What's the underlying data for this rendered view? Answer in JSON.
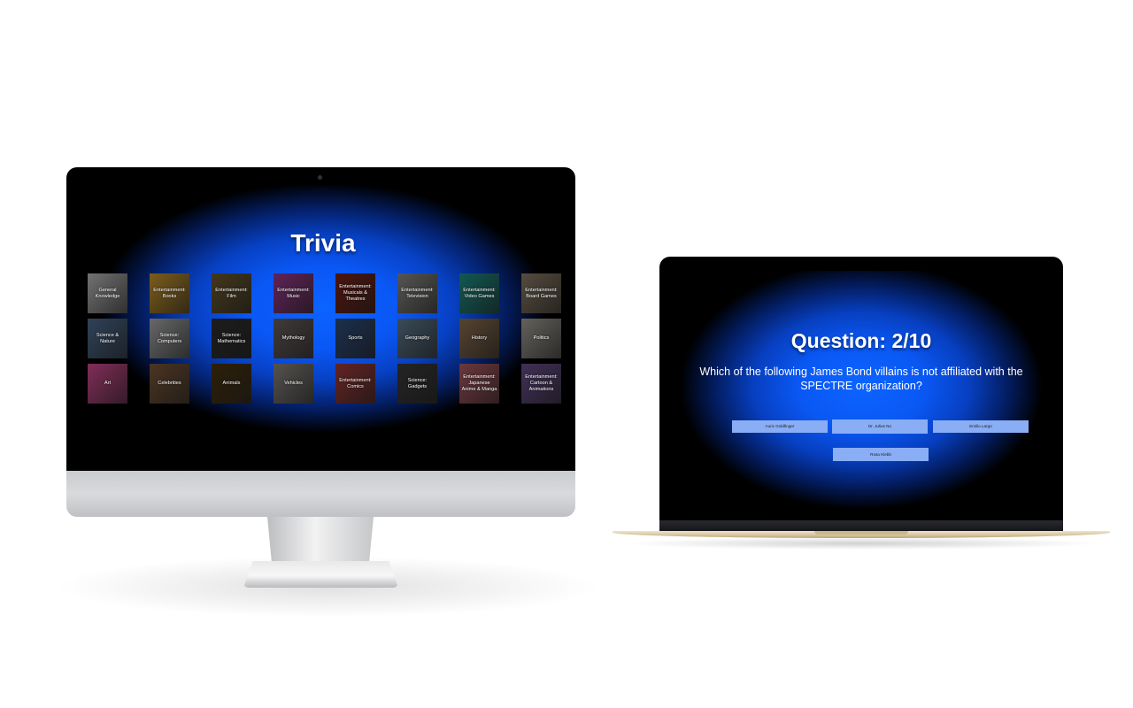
{
  "home": {
    "title": "Trivia",
    "categories": [
      {
        "label": "General Knowledge",
        "bg": "#b9b9b9"
      },
      {
        "label": "Entertainment: Books",
        "bg": "#c9962c"
      },
      {
        "label": "Entertainment: Film",
        "bg": "#6e5a2e"
      },
      {
        "label": "Entertainment: Music",
        "bg": "#9b3a8d"
      },
      {
        "label": "Entertainment: Musicals & Theatres",
        "bg": "#7a2318"
      },
      {
        "label": "Entertainment: Television",
        "bg": "#8a8a86"
      },
      {
        "label": "Entertainment: Video Games",
        "bg": "#1e8f86"
      },
      {
        "label": "Entertainment: Board Games",
        "bg": "#8b7b66"
      },
      {
        "label": "Science & Nature",
        "bg": "#4d6c8f"
      },
      {
        "label": "Science: Computers",
        "bg": "#a7a8aa"
      },
      {
        "label": "Science: Mathematics",
        "bg": "#2f2f2f"
      },
      {
        "label": "Mythology",
        "bg": "#6a6060"
      },
      {
        "label": "Sports",
        "bg": "#2e4d7e"
      },
      {
        "label": "Geography",
        "bg": "#5e7a90"
      },
      {
        "label": "History",
        "bg": "#8b6e4e"
      },
      {
        "label": "Politics",
        "bg": "#a29e96"
      },
      {
        "label": "Art",
        "bg": "#d04a8f"
      },
      {
        "label": "Celebrities",
        "bg": "#7a5638"
      },
      {
        "label": "Animals",
        "bg": "#4a3410"
      },
      {
        "label": "Vehicles",
        "bg": "#8a8580"
      },
      {
        "label": "Entertainment: Comics",
        "bg": "#a23a3a"
      },
      {
        "label": "Science: Gadgets",
        "bg": "#3b3b3b"
      },
      {
        "label": "Entertainment: Japanese Anime & Manga",
        "bg": "#b05a64"
      },
      {
        "label": "Entertainment: Cartoon & Animations",
        "bg": "#6a4f8e"
      }
    ]
  },
  "quiz": {
    "question_counter": "Question: 2/10",
    "question_text": "Which of the following James Bond villains is not affiliated with the SPECTRE organization?",
    "answers": [
      "Auric Goldfinger",
      "Dr. Julius No",
      "Emilio Largo",
      "Rosa Klebb"
    ]
  },
  "colors": {
    "screen_blue": "#0a58f4",
    "answer_button": "#8aaef5"
  }
}
